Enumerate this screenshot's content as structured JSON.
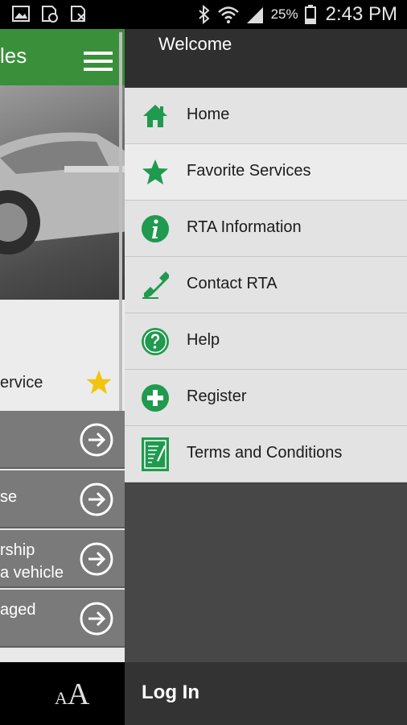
{
  "status_bar": {
    "battery_percent": "25%",
    "time": "2:43 PM",
    "left_icons": [
      "gallery-icon",
      "sim-settings-icon",
      "no-sim-icon"
    ],
    "right_icons": [
      "bluetooth-icon",
      "wifi-icon",
      "signal-icon",
      "battery-icon"
    ]
  },
  "background_app": {
    "title_fragment": "les",
    "favorite_service_fragment": "ervice",
    "list_rows": [
      {
        "line1": "",
        "line2": ""
      },
      {
        "line1": "se",
        "line2": ""
      },
      {
        "line1": "rship",
        "line2": "a vehicle"
      },
      {
        "line1": "aged",
        "line2": ""
      }
    ],
    "font_size_small": "A",
    "font_size_large": "A"
  },
  "drawer": {
    "welcome": "Welcome",
    "items": [
      {
        "label": "Home",
        "icon": "home-icon"
      },
      {
        "label": "Favorite Services",
        "icon": "star-icon"
      },
      {
        "label": "RTA Information",
        "icon": "info-icon"
      },
      {
        "label": "Contact RTA",
        "icon": "phone-icon"
      },
      {
        "label": "Help",
        "icon": "help-icon"
      },
      {
        "label": "Register",
        "icon": "add-icon"
      },
      {
        "label": "Terms and Conditions",
        "icon": "document-icon"
      }
    ],
    "login": "Log In"
  },
  "colors": {
    "brand_green": "#3a8f3a",
    "icon_green": "#1f9a4f",
    "star_yellow": "#f1c40f"
  }
}
